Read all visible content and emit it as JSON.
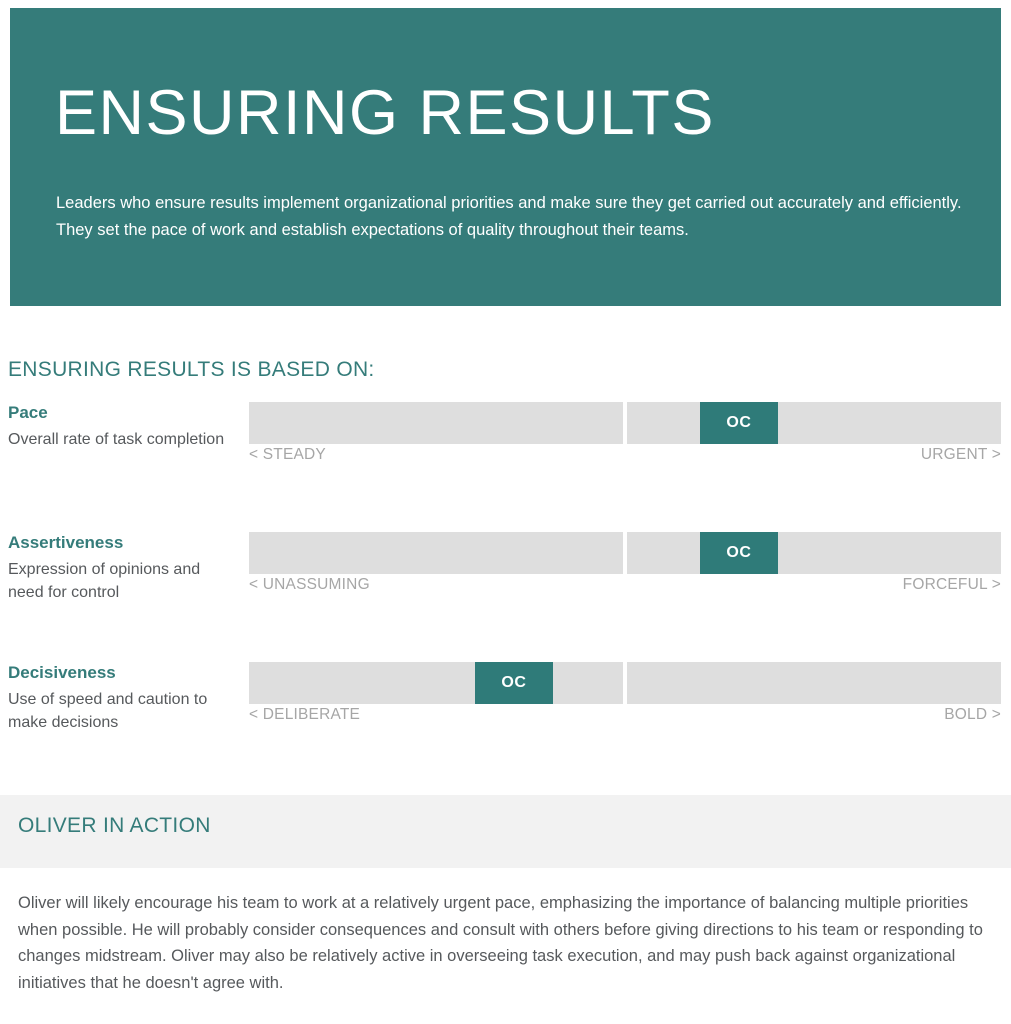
{
  "colors": {
    "brand_teal": "#357c7a",
    "marker_teal": "#2f7b79",
    "track_gray": "#dedede",
    "band_gray": "#f2f2f2",
    "anchor_gray": "#a6a6a6",
    "body_text": "#56595c"
  },
  "hero": {
    "title": "ENSURING RESULTS",
    "description": "Leaders who ensure results implement organizational priorities and make sure they get carried out accurately and efficiently. They set the pace of work and establish expectations of quality throughout their teams."
  },
  "based_on": {
    "heading": "ENSURING RESULTS IS BASED ON:"
  },
  "chart_data": {
    "type": "bar",
    "title": "ENSURING RESULTS IS BASED ON:",
    "xlabel": "",
    "ylabel": "",
    "grid": false,
    "legend": "none",
    "axis_note": "Each scale is a bipolar continuum split into two equal halves; the marker labeled OC shows the subject's placement.",
    "marker_label": "OC",
    "xlim": [
      0,
      100
    ],
    "categories": [
      "Pace",
      "Assertiveness",
      "Decisiveness"
    ],
    "values": [
      60,
      60,
      34
    ],
    "series": [
      {
        "name": "OC",
        "values": [
          60,
          60,
          34
        ]
      }
    ],
    "scales": [
      {
        "name": "Pace",
        "description": "Overall rate of task completion",
        "low_anchor": "< STEADY",
        "high_anchor": "URGENT >",
        "marker_label": "OC",
        "marker_percent": 60
      },
      {
        "name": "Assertiveness",
        "description": "Expression of opinions and need for control",
        "low_anchor": "< UNASSUMING",
        "high_anchor": "FORCEFUL >",
        "marker_label": "OC",
        "marker_percent": 60
      },
      {
        "name": "Decisiveness",
        "description": "Use of speed and caution to make decisions",
        "low_anchor": "< DELIBERATE",
        "high_anchor": "BOLD >",
        "marker_label": "OC",
        "marker_percent": 34
      }
    ]
  },
  "action": {
    "heading": "OLIVER IN ACTION",
    "body": "Oliver will likely encourage his team to work at a relatively urgent pace, emphasizing the importance of balancing multiple priorities when possible. He will probably consider consequences and consult with others before giving directions to his team or responding to changes midstream. Oliver may also be relatively active in overseeing task execution, and may push back against organizational initiatives that he doesn't agree with."
  }
}
